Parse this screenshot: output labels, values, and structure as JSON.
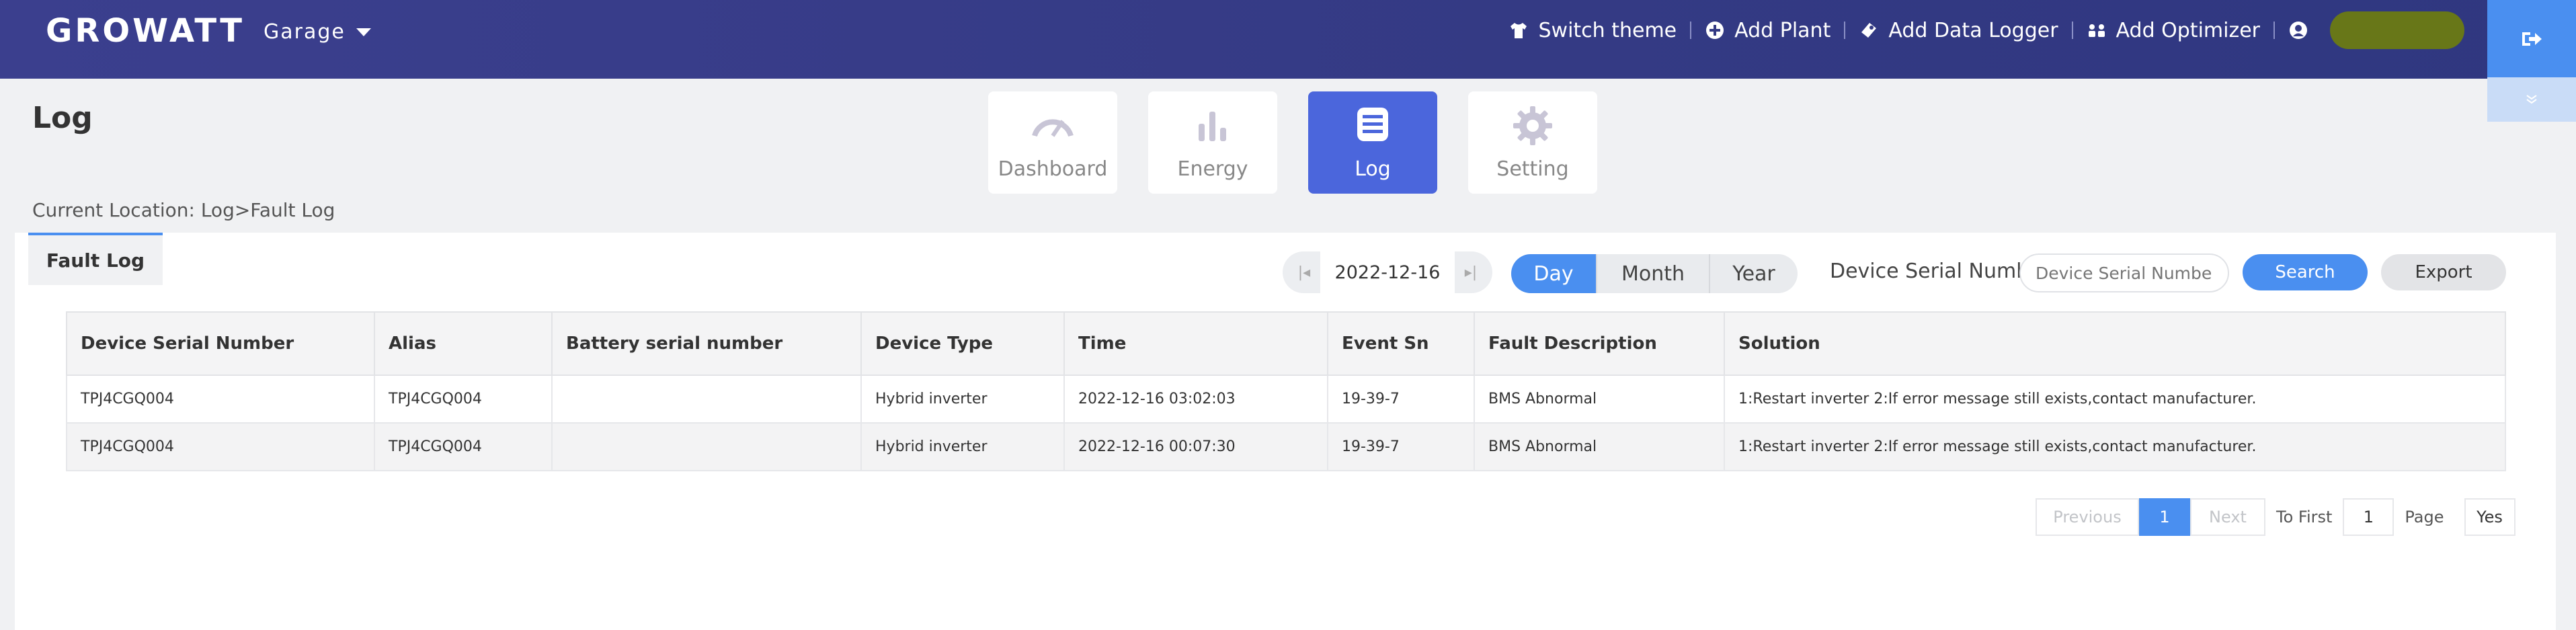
{
  "header": {
    "logo": "GROWATT",
    "plant": "Garage",
    "nav": [
      {
        "label": "Switch theme",
        "icon": "shirt-icon"
      },
      {
        "label": "Add Plant",
        "icon": "plus-circle-icon"
      },
      {
        "label": "Add Data Logger",
        "icon": "logger-icon"
      },
      {
        "label": "Add Optimizer",
        "icon": "optimizer-icon"
      }
    ],
    "user_icon": "user-icon",
    "colors": {
      "bar": "#343a84",
      "accent": "#4a8ff0"
    }
  },
  "page": {
    "title": "Log",
    "breadcrumb": "Current Location: Log>Fault Log"
  },
  "tabs": [
    {
      "label": "Dashboard",
      "icon": "gauge-icon",
      "active": false
    },
    {
      "label": "Energy",
      "icon": "bar-chart-icon",
      "active": false
    },
    {
      "label": "Log",
      "icon": "log-icon",
      "active": true
    },
    {
      "label": "Setting",
      "icon": "gear-icon",
      "active": false
    }
  ],
  "fault_log": {
    "tab_label": "Fault Log",
    "date": "2022-12-16",
    "periods": [
      "Day",
      "Month",
      "Year"
    ],
    "selected_period": "Day",
    "serial_label": "Device Serial Number",
    "serial_placeholder": "Device Serial Number",
    "search_label": "Search",
    "export_label": "Export"
  },
  "table": {
    "columns": [
      "Device Serial Number",
      "Alias",
      "Battery serial number",
      "Device Type",
      "Time",
      "Event Sn",
      "Fault Description",
      "Solution"
    ],
    "rows": [
      [
        "TPJ4CGQ004",
        "TPJ4CGQ004",
        "",
        "Hybrid inverter",
        "2022-12-16 03:02:03",
        "19-39-7",
        "BMS Abnormal",
        "1:Restart inverter 2:If error message still exists,contact manufacturer."
      ],
      [
        "TPJ4CGQ004",
        "TPJ4CGQ004",
        "",
        "Hybrid inverter",
        "2022-12-16 00:07:30",
        "19-39-7",
        "BMS Abnormal",
        "1:Restart inverter 2:If error message still exists,contact manufacturer."
      ]
    ]
  },
  "pagination": {
    "previous": "Previous",
    "current": "1",
    "next": "Next",
    "to_first": "To First",
    "page_input": "1",
    "page_label": "Page",
    "go": "Yes"
  }
}
